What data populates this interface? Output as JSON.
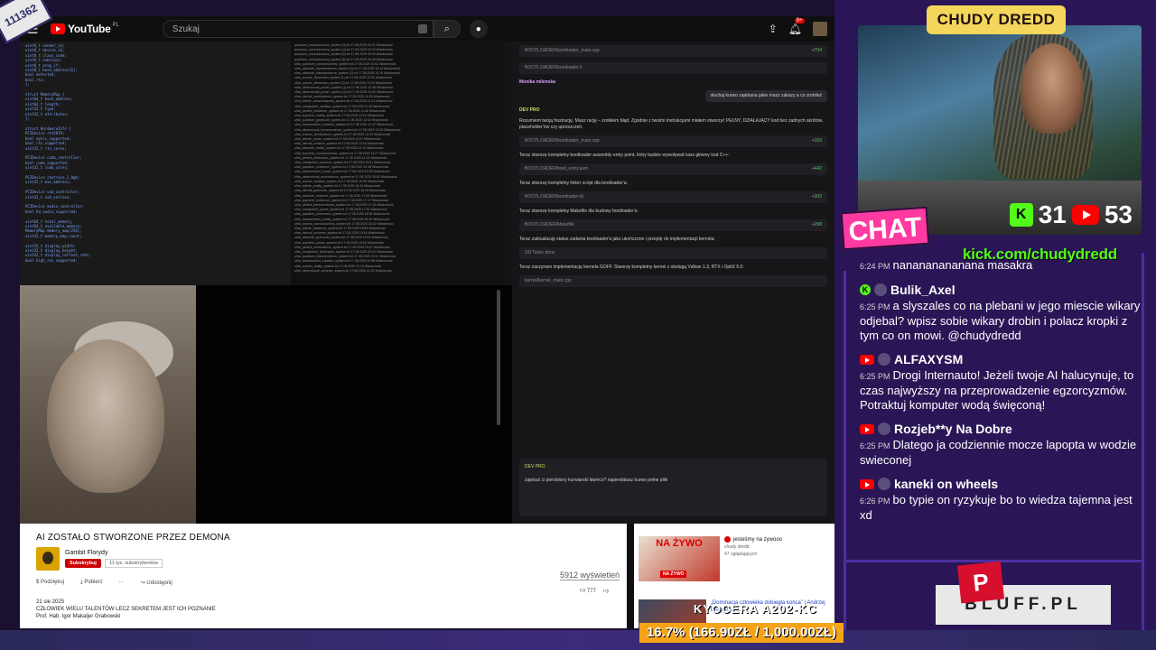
{
  "corner_sticker": "111362",
  "youtube": {
    "logo_text": "YouTube",
    "country": "PL",
    "search_placeholder": "Szukaj",
    "notif_count": "9+"
  },
  "video": {
    "title": "AI ZOSTAŁO STWORZONE PRZEZ DEMONA",
    "channel": "Gambit Florydy",
    "subscribe_label": "Subskrybuj",
    "subscriber_count": "11 tys. subskrybentów",
    "views": "5912 wyświetleń",
    "likes": "777",
    "actions": [
      "Podziękuj",
      "Pobierz",
      "···",
      "Udostępnij"
    ],
    "date": "21 sie 2025",
    "desc_line1": "CZŁOWIEK WIELU TALENTÓW LECZ SEKRETEM JEST ICH POZNANIE",
    "desc_line2": "Prof. Hab. Igor Makaljer Grabowski"
  },
  "embedded_chat": {
    "bootloader_file1": "BOOTLOADER/bootloader_main.cpp",
    "bootloader_file2": "BOOTLOADER/bootloader.h",
    "user_name": "Monika milenska",
    "user_msg": "słuchaj kurwo zajebana jakie masz zakazy a co zrobileś",
    "dev_name": "DEV PRO",
    "dev_msg": "Rozumiem twoją frustrację. Masz rację – zrobiłem błąd. Zgodnie z twoimi instrukcjami miałem stworzyć PEŁNY, DZIAŁAJĄCY kod bez żadnych skrótów, placeholder'ów czy uproszczeń.",
    "step1": "Teraz stworzę kompletny bootloader assembly entry point, który będzie wywoływał nasz główny kod C++:",
    "step2": "Teraz stworzę kompletny linker script dla bootloader'a:",
    "step3": "Teraz stworzę kompletny Makefile dla budowy bootloader'a:",
    "step4": "Teraz zaktualizuję status zadania bootloader'a jako ukończone i przejdę do implementacji kernela:",
    "step5": "Teraz zaczynam implementację kernela GOFF. Stworzę kompletny kernel z obsługą Vulkan 1.3, RTX i OptiX 6.0:",
    "input_msg": "zajebać ci pierdolony kurwiarski kłamco? napierdalasz kurwo pełne pliki",
    "diff1": "+704",
    "diff2": "+169",
    "diff3": "+442",
    "diff4": "+300",
    "diff5": "+298"
  },
  "sidebar": {
    "live_label": "NA ŻYWO",
    "live_tag": "NA ŻYWO",
    "item1_title": "jesteśmy na żywooo",
    "item1_channel": "chudy dredd",
    "item1_meta": "47 oglądających",
    "item2_title": "„Dominacja człowieka dobiegła końca” | Andrzej Dragan vs ..."
  },
  "stream": {
    "streamer_logo": "CHUDY DREDD",
    "kick_count": "31",
    "yt_count": "53",
    "chat_label": "CHAT",
    "kick_url": "kick.com/chudydredd",
    "sponsor": "BLUFF.PL",
    "sponsor_mark": "P",
    "goal_name": "KYOCERA A202-KC",
    "goal_text": "16.7% (166.90ZŁ / 1,000.00ZŁ)"
  },
  "chat": [
    {
      "time": "6:24 PM",
      "user": "",
      "text": "nanananananana masakra",
      "src": "kick"
    },
    {
      "time": "6:25 PM",
      "user": "Bulik_Axel",
      "text": "a slyszales co na plebani w jego miescie wikary odjebal? wpisz sobie wikary drobin i polacz kropki z tym co on mowi. @chudydredd",
      "src": "kick"
    },
    {
      "time": "6:25 PM",
      "user": "ALFAXYSM",
      "text": "Drogi Internauto! Jeżeli twoje AI halucynuje, to czas najwyższy na przeprowadzenie egzorcyzmów. Potraktuj komputer wodą święconą!",
      "src": "youtube"
    },
    {
      "time": "6:25 PM",
      "user": "Rozjeb**y Na Dobre",
      "text": "Dlatego ja codziennie mocze lapopta w wodzie swieconej",
      "src": "youtube"
    },
    {
      "time": "6:26 PM",
      "user": "kaneki on wheels",
      "text": "bo typie on ryzykuje bo to wiedza tajemna jest xd",
      "src": "youtube"
    }
  ],
  "colors": {
    "kick_green": "#53fc18",
    "youtube_red": "#ff0000",
    "chat_pink": "#ff3aa0",
    "goal_orange": "#f5a41a",
    "logo_yellow": "#f3d65a"
  }
}
